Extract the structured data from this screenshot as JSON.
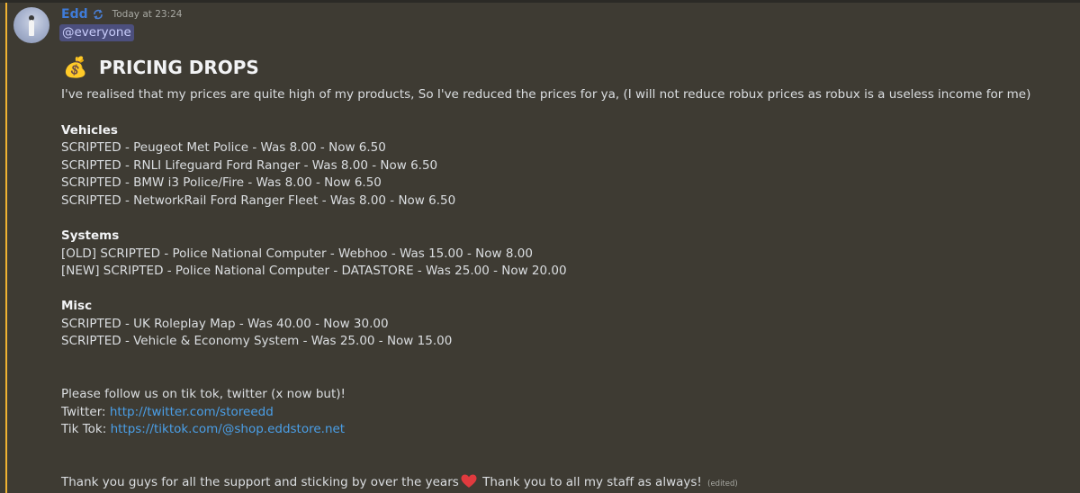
{
  "message": {
    "author": "Edd",
    "timestamp": "Today at 23:24",
    "mention": "@everyone",
    "heading_emoji": "💰",
    "heading": "PRICING DROPS",
    "intro": "I've realised that my prices are quite high of my products, So I've reduced the prices for ya, (I will not reduce robux prices as robux is a useless income for me)",
    "sections": {
      "vehicles": {
        "title": "Vehicles",
        "items": [
          "SCRIPTED - Peugeot Met Police - Was 8.00 - Now 6.50",
          "SCRIPTED - RNLI Lifeguard Ford Ranger - Was 8.00 - Now 6.50",
          "SCRIPTED - BMW i3 Police/Fire - Was 8.00 - Now 6.50",
          "SCRIPTED - NetworkRail Ford Ranger Fleet - Was 8.00 - Now 6.50"
        ]
      },
      "systems": {
        "title": "Systems",
        "items": [
          "[OLD] SCRIPTED - Police National Computer - Webhoo - Was 15.00 - Now 8.00",
          "[NEW] SCRIPTED - Police National Computer - DATASTORE - Was 25.00 - Now 20.00"
        ]
      },
      "misc": {
        "title": "Misc",
        "items": [
          "SCRIPTED - UK Roleplay Map - Was 40.00 - Now 30.00",
          "SCRIPTED - Vehicle & Economy System - Was 25.00 - Now 15.00"
        ]
      }
    },
    "follow_text": "Please follow us on tik tok, twitter (x now but)!",
    "twitter_label": "Twitter: ",
    "twitter_url": "http://twitter.com/storeedd",
    "tiktok_label": "Tik Tok: ",
    "tiktok_url": "https://tiktok.com/@shop.eddstore.net",
    "thanks_1": "Thank you guys for all the support and sticking by over the years",
    "thanks_2": " Thank you to all my staff as always! ",
    "edited": "(edited)",
    "colors": {
      "background": "#3e3b33",
      "username": "#3f7bd8",
      "link": "#4a9fe8",
      "mention_bg": "#4c4f7d",
      "mention_bar": "#f0b232",
      "heart": "#e03a3e"
    }
  }
}
